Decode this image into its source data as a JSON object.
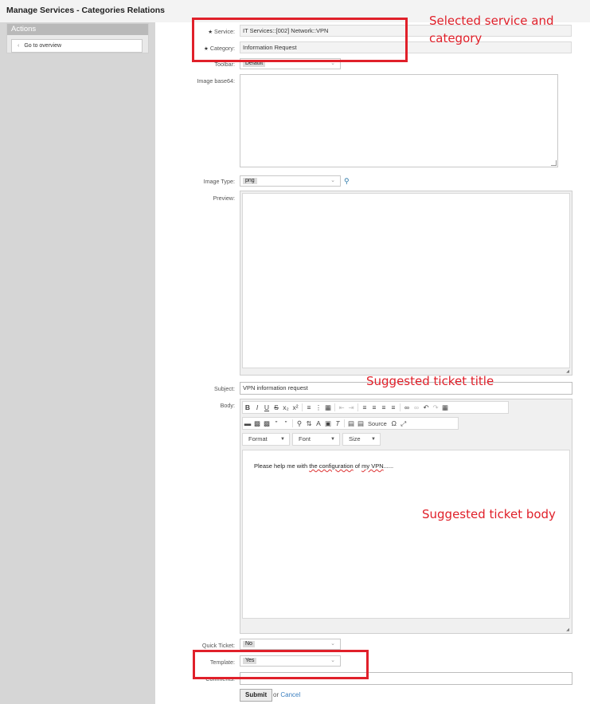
{
  "page_title": "Manage Services - Categories Relations",
  "sidebar": {
    "actions_header": "Actions",
    "go_to_overview": "Go to overview"
  },
  "form": {
    "service_label": "Service:",
    "service_value": "IT Services::[002] Network::VPN",
    "category_label": "Category:",
    "category_value": "Information Request",
    "toolbar_label": "Toolbar:",
    "toolbar_value": "Default",
    "image_base64_label": "Image base64:",
    "image_type_label": "Image Type:",
    "image_type_value": "png",
    "preview_label": "Preview:",
    "subject_label": "Subject:",
    "subject_value": "VPN information request",
    "body_label": "Body:",
    "body_text_1": "Please help me with ",
    "body_text_2": "the configuration",
    "body_text_3": " of ",
    "body_text_4": "my VPN",
    "body_text_5": "......",
    "quick_ticket_label": "Quick Ticket:",
    "quick_ticket_value": "No",
    "template_label": "Template:",
    "template_value": "Yes",
    "comments_label": "Comments:",
    "submit_label": "Submit",
    "or_text": "or",
    "cancel_label": "Cancel",
    "required_mark": "★"
  },
  "editor": {
    "source_label": "Source",
    "format_label": "Format",
    "font_label": "Font",
    "size_label": "Size"
  },
  "annotations": {
    "selected_service": "Selected service and category",
    "suggested_title": "Suggested ticket title",
    "suggested_body": "Suggested ticket body"
  },
  "colors": {
    "annotation_red": "#e0202a",
    "link_blue": "#3a7ebf",
    "sidebar_gray": "#d6d6d6"
  }
}
